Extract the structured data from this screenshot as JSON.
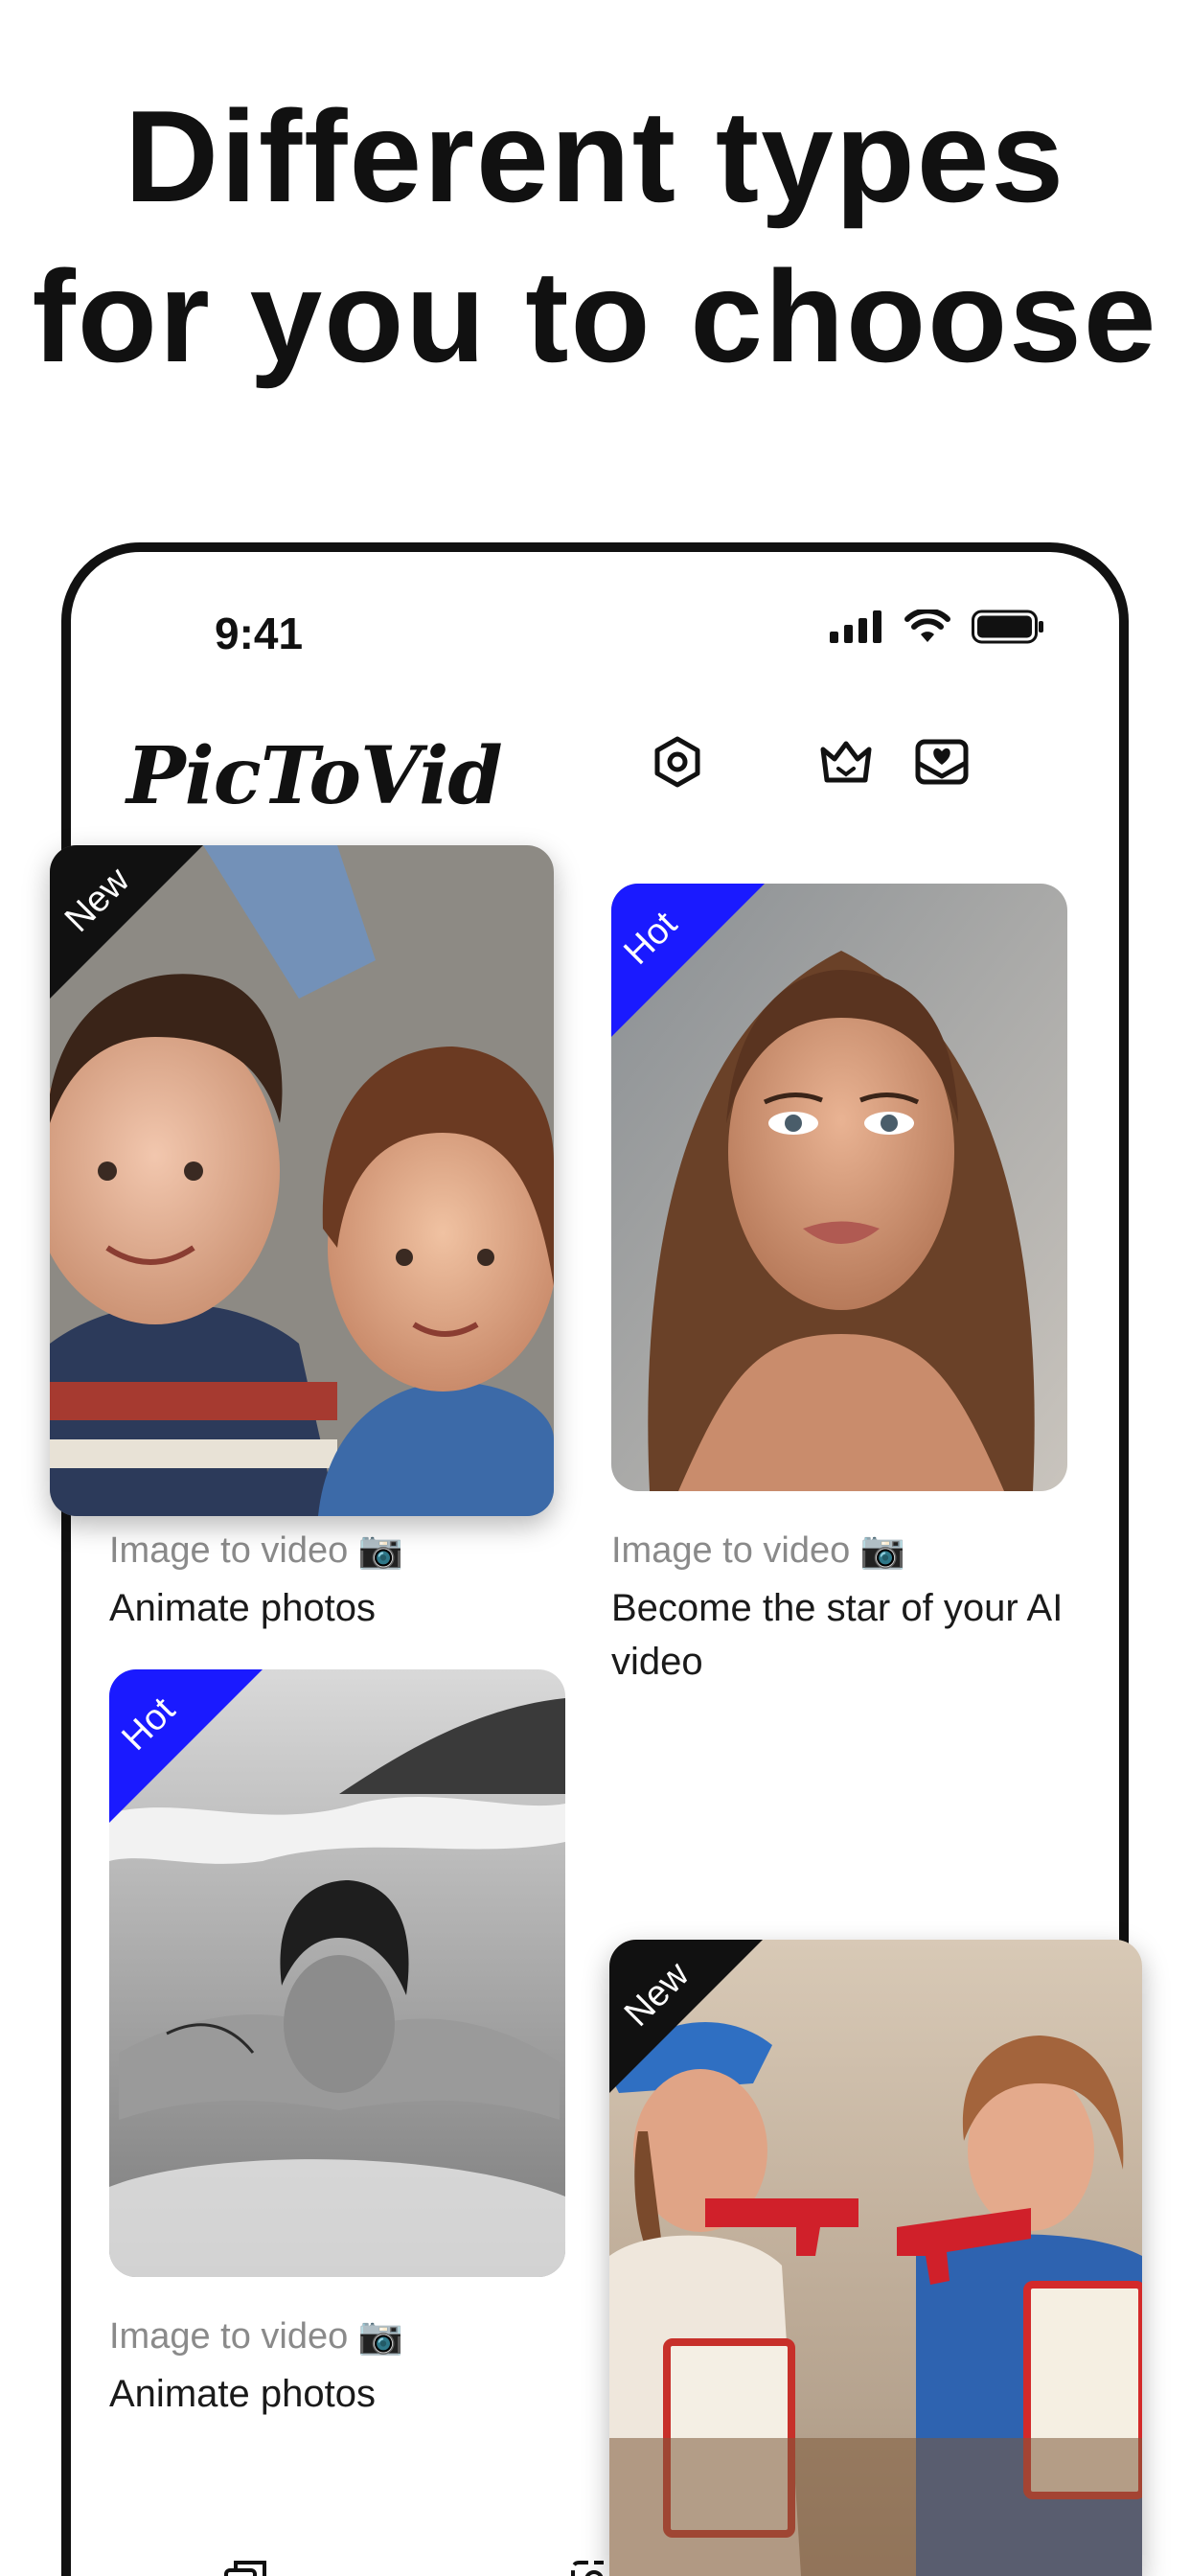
{
  "headline": {
    "line1": "Different types",
    "line2": "for you to choose"
  },
  "status": {
    "time": "9:41",
    "icons": [
      "signal-icon",
      "wifi-icon",
      "battery-icon"
    ]
  },
  "app": {
    "brand": "PicToVid",
    "header_icons": [
      "hexagon-settings-icon",
      "crown-icon",
      "mail-heart-icon"
    ]
  },
  "cards": [
    {
      "badge": "New",
      "badge_color": "#111111",
      "type_label": "Image to video 📷",
      "title": "Animate photos",
      "image": "photo-two-children"
    },
    {
      "badge": "Hot",
      "badge_color": "#1a1aff",
      "type_label": "Image to video 📷",
      "title": "Become the star of your AI video",
      "image": "photo-woman-portrait"
    },
    {
      "badge": "Hot",
      "badge_color": "#1a1aff",
      "type_label": "Image to video 📷",
      "title": "Animate photos",
      "image": "photo-surfer-bw"
    },
    {
      "badge": "New",
      "badge_color": "#111111",
      "image": "photo-two-girls-toy-guns"
    }
  ],
  "colors": {
    "hot": "#1a1aff",
    "new": "#111111"
  },
  "tabbar": {
    "icons": [
      "copy-icon",
      "person-icon"
    ]
  }
}
